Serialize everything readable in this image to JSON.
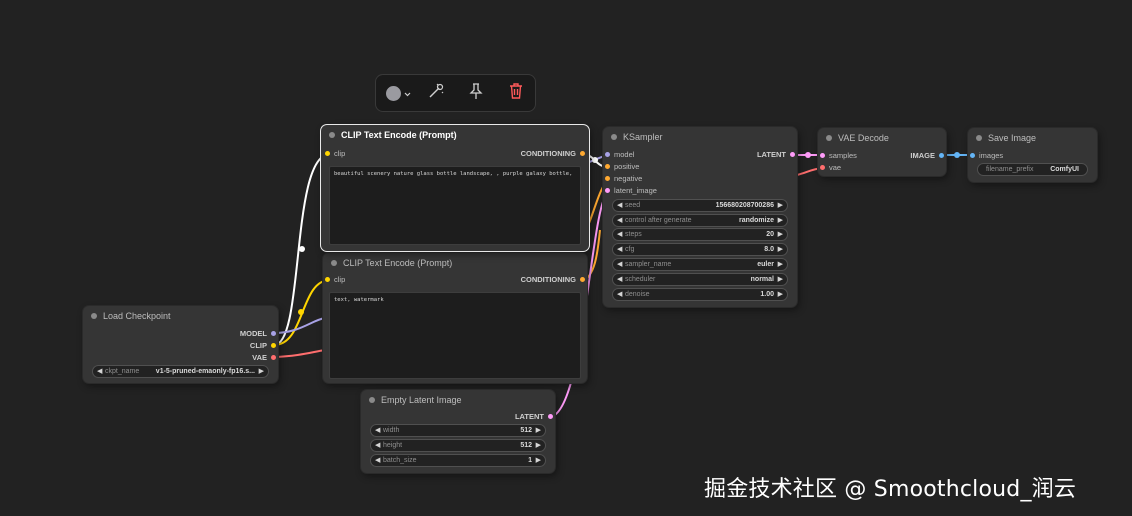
{
  "toolbar": {
    "color_icon": "color-circle-icon",
    "color_value": "#9a9aa0",
    "icons": [
      "bypass-wand-icon",
      "pin-icon",
      "trash-icon"
    ]
  },
  "colors": {
    "model": "#a8a2e6",
    "clip": "#ffd500",
    "vae": "#ff6e6e",
    "conditioning": "#ffa931",
    "latent": "#ff9cf9",
    "image": "#64b5f6"
  },
  "nodes": {
    "load_checkpoint": {
      "title": "Load Checkpoint",
      "outputs": [
        "MODEL",
        "CLIP",
        "VAE"
      ],
      "ckpt_label": "ckpt_name",
      "ckpt_value": "v1-5-pruned-emaonly-fp16.s..."
    },
    "clip_pos": {
      "title": "CLIP Text Encode (Prompt)",
      "input": "clip",
      "output": "CONDITIONING",
      "text": "beautiful scenery nature glass bottle landscape, , purple galaxy bottle,"
    },
    "clip_neg": {
      "title": "CLIP Text Encode (Prompt)",
      "input": "clip",
      "output": "CONDITIONING",
      "text": "text, watermark"
    },
    "ksampler": {
      "title": "KSampler",
      "inputs": [
        "model",
        "positive",
        "negative",
        "latent_image"
      ],
      "output": "LATENT",
      "widgets": [
        {
          "label": "seed",
          "value": "156680208700286"
        },
        {
          "label": "control after generate",
          "value": "randomize"
        },
        {
          "label": "steps",
          "value": "20"
        },
        {
          "label": "cfg",
          "value": "8.0"
        },
        {
          "label": "sampler_name",
          "value": "euler"
        },
        {
          "label": "scheduler",
          "value": "normal"
        },
        {
          "label": "denoise",
          "value": "1.00"
        }
      ]
    },
    "vae_decode": {
      "title": "VAE Decode",
      "inputs": [
        "samples",
        "vae"
      ],
      "output": "IMAGE"
    },
    "save_image": {
      "title": "Save Image",
      "input": "images",
      "prefix_label": "filename_prefix",
      "prefix_value": "ComfyUI"
    },
    "empty_latent": {
      "title": "Empty Latent Image",
      "output": "LATENT",
      "widgets": [
        {
          "label": "width",
          "value": "512"
        },
        {
          "label": "height",
          "value": "512"
        },
        {
          "label": "batch_size",
          "value": "1"
        }
      ]
    }
  },
  "watermark": "掘金技术社区 @ Smoothcloud_润云"
}
